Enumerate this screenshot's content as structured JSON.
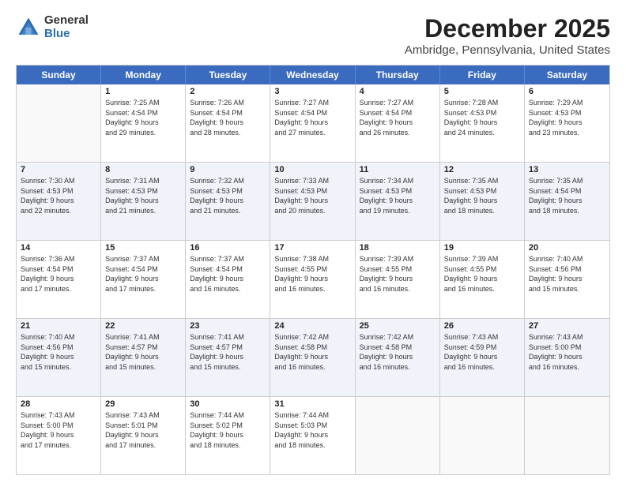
{
  "logo": {
    "general": "General",
    "blue": "Blue"
  },
  "title": "December 2025",
  "subtitle": "Ambridge, Pennsylvania, United States",
  "headers": [
    "Sunday",
    "Monday",
    "Tuesday",
    "Wednesday",
    "Thursday",
    "Friday",
    "Saturday"
  ],
  "weeks": [
    [
      {
        "day": "",
        "info": ""
      },
      {
        "day": "1",
        "info": "Sunrise: 7:25 AM\nSunset: 4:54 PM\nDaylight: 9 hours\nand 29 minutes."
      },
      {
        "day": "2",
        "info": "Sunrise: 7:26 AM\nSunset: 4:54 PM\nDaylight: 9 hours\nand 28 minutes."
      },
      {
        "day": "3",
        "info": "Sunrise: 7:27 AM\nSunset: 4:54 PM\nDaylight: 9 hours\nand 27 minutes."
      },
      {
        "day": "4",
        "info": "Sunrise: 7:27 AM\nSunset: 4:54 PM\nDaylight: 9 hours\nand 26 minutes."
      },
      {
        "day": "5",
        "info": "Sunrise: 7:28 AM\nSunset: 4:53 PM\nDaylight: 9 hours\nand 24 minutes."
      },
      {
        "day": "6",
        "info": "Sunrise: 7:29 AM\nSunset: 4:53 PM\nDaylight: 9 hours\nand 23 minutes."
      }
    ],
    [
      {
        "day": "7",
        "info": "Sunrise: 7:30 AM\nSunset: 4:53 PM\nDaylight: 9 hours\nand 22 minutes."
      },
      {
        "day": "8",
        "info": "Sunrise: 7:31 AM\nSunset: 4:53 PM\nDaylight: 9 hours\nand 21 minutes."
      },
      {
        "day": "9",
        "info": "Sunrise: 7:32 AM\nSunset: 4:53 PM\nDaylight: 9 hours\nand 21 minutes."
      },
      {
        "day": "10",
        "info": "Sunrise: 7:33 AM\nSunset: 4:53 PM\nDaylight: 9 hours\nand 20 minutes."
      },
      {
        "day": "11",
        "info": "Sunrise: 7:34 AM\nSunset: 4:53 PM\nDaylight: 9 hours\nand 19 minutes."
      },
      {
        "day": "12",
        "info": "Sunrise: 7:35 AM\nSunset: 4:53 PM\nDaylight: 9 hours\nand 18 minutes."
      },
      {
        "day": "13",
        "info": "Sunrise: 7:35 AM\nSunset: 4:54 PM\nDaylight: 9 hours\nand 18 minutes."
      }
    ],
    [
      {
        "day": "14",
        "info": "Sunrise: 7:36 AM\nSunset: 4:54 PM\nDaylight: 9 hours\nand 17 minutes."
      },
      {
        "day": "15",
        "info": "Sunrise: 7:37 AM\nSunset: 4:54 PM\nDaylight: 9 hours\nand 17 minutes."
      },
      {
        "day": "16",
        "info": "Sunrise: 7:37 AM\nSunset: 4:54 PM\nDaylight: 9 hours\nand 16 minutes."
      },
      {
        "day": "17",
        "info": "Sunrise: 7:38 AM\nSunset: 4:55 PM\nDaylight: 9 hours\nand 16 minutes."
      },
      {
        "day": "18",
        "info": "Sunrise: 7:39 AM\nSunset: 4:55 PM\nDaylight: 9 hours\nand 16 minutes."
      },
      {
        "day": "19",
        "info": "Sunrise: 7:39 AM\nSunset: 4:55 PM\nDaylight: 9 hours\nand 16 minutes."
      },
      {
        "day": "20",
        "info": "Sunrise: 7:40 AM\nSunset: 4:56 PM\nDaylight: 9 hours\nand 15 minutes."
      }
    ],
    [
      {
        "day": "21",
        "info": "Sunrise: 7:40 AM\nSunset: 4:56 PM\nDaylight: 9 hours\nand 15 minutes."
      },
      {
        "day": "22",
        "info": "Sunrise: 7:41 AM\nSunset: 4:57 PM\nDaylight: 9 hours\nand 15 minutes."
      },
      {
        "day": "23",
        "info": "Sunrise: 7:41 AM\nSunset: 4:57 PM\nDaylight: 9 hours\nand 15 minutes."
      },
      {
        "day": "24",
        "info": "Sunrise: 7:42 AM\nSunset: 4:58 PM\nDaylight: 9 hours\nand 16 minutes."
      },
      {
        "day": "25",
        "info": "Sunrise: 7:42 AM\nSunset: 4:58 PM\nDaylight: 9 hours\nand 16 minutes."
      },
      {
        "day": "26",
        "info": "Sunrise: 7:43 AM\nSunset: 4:59 PM\nDaylight: 9 hours\nand 16 minutes."
      },
      {
        "day": "27",
        "info": "Sunrise: 7:43 AM\nSunset: 5:00 PM\nDaylight: 9 hours\nand 16 minutes."
      }
    ],
    [
      {
        "day": "28",
        "info": "Sunrise: 7:43 AM\nSunset: 5:00 PM\nDaylight: 9 hours\nand 17 minutes."
      },
      {
        "day": "29",
        "info": "Sunrise: 7:43 AM\nSunset: 5:01 PM\nDaylight: 9 hours\nand 17 minutes."
      },
      {
        "day": "30",
        "info": "Sunrise: 7:44 AM\nSunset: 5:02 PM\nDaylight: 9 hours\nand 18 minutes."
      },
      {
        "day": "31",
        "info": "Sunrise: 7:44 AM\nSunset: 5:03 PM\nDaylight: 9 hours\nand 18 minutes."
      },
      {
        "day": "",
        "info": ""
      },
      {
        "day": "",
        "info": ""
      },
      {
        "day": "",
        "info": ""
      }
    ]
  ]
}
